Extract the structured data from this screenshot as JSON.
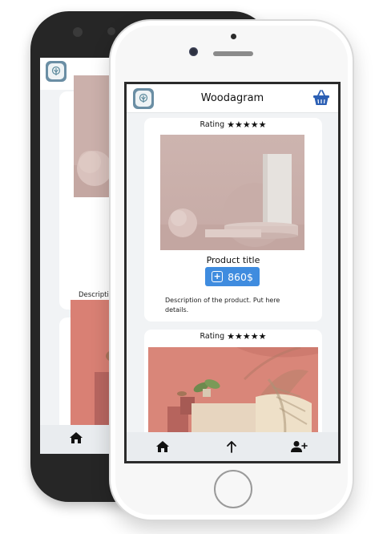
{
  "app": {
    "title": "Woodagram"
  },
  "products": [
    {
      "rating_label": "Rating",
      "stars": [
        "★",
        "★",
        "★",
        "★",
        "★"
      ],
      "title": "Product title",
      "price": "860$",
      "description": "Description of the product. Put here details."
    },
    {
      "rating_label": "Rating",
      "stars": [
        "★",
        "★",
        "★",
        "★",
        "★"
      ]
    }
  ],
  "back_phone": {
    "description": "Description details."
  },
  "nav": {
    "items": [
      "home-icon",
      "arrow-up-icon",
      "add-user-icon"
    ]
  },
  "colors": {
    "accent": "#3f8cdf",
    "logo": "#6a8ea4",
    "cart": "#2b5fb4"
  }
}
